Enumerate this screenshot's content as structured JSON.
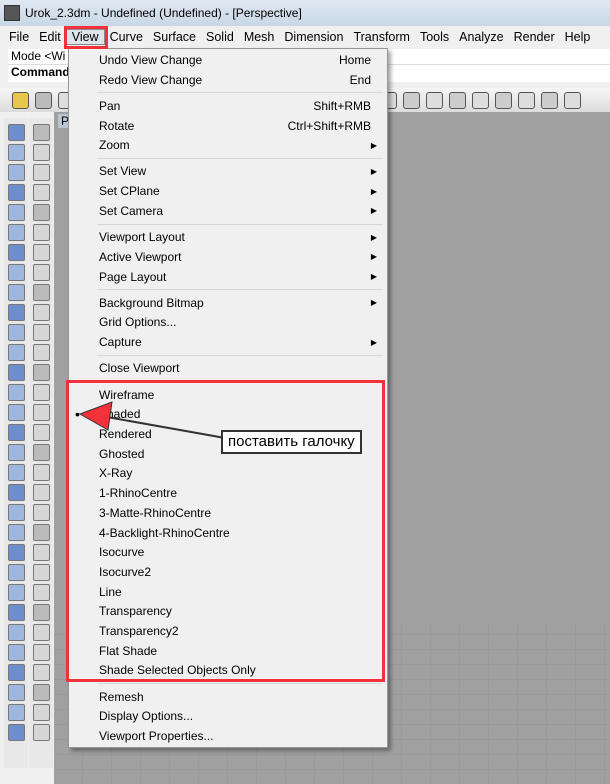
{
  "window": {
    "title": "Urok_2.3dm - Undefined (Undefined) - [Perspective]"
  },
  "menubar": [
    "File",
    "Edit",
    "View",
    "Curve",
    "Surface",
    "Solid",
    "Mesh",
    "Dimension",
    "Transform",
    "Tools",
    "Analyze",
    "Render",
    "Help"
  ],
  "mode_row": "Mode <Wi                                                                         RhinoCentre  3MatteRhinoCentre  4Backlig",
  "command_label": "Command",
  "viewport_title": "P",
  "view_menu": [
    {
      "label": "Undo View Change",
      "shortcut": "Home"
    },
    {
      "label": "Redo View Change",
      "shortcut": "End"
    },
    {
      "sep": true
    },
    {
      "label": "Pan",
      "shortcut": "Shift+RMB"
    },
    {
      "label": "Rotate",
      "shortcut": "Ctrl+Shift+RMB"
    },
    {
      "label": "Zoom",
      "submenu": true
    },
    {
      "sep": true
    },
    {
      "label": "Set View",
      "submenu": true
    },
    {
      "label": "Set CPlane",
      "submenu": true
    },
    {
      "label": "Set Camera",
      "submenu": true
    },
    {
      "sep": true
    },
    {
      "label": "Viewport Layout",
      "submenu": true
    },
    {
      "label": "Active Viewport",
      "submenu": true
    },
    {
      "label": "Page Layout",
      "submenu": true
    },
    {
      "sep": true
    },
    {
      "label": "Background Bitmap",
      "submenu": true
    },
    {
      "label": "Grid Options..."
    },
    {
      "label": "Capture",
      "submenu": true
    },
    {
      "sep": true
    },
    {
      "label": "Close Viewport"
    },
    {
      "sep": true
    },
    {
      "label": "Wireframe"
    },
    {
      "label": "Shaded",
      "checked": true
    },
    {
      "label": "Rendered"
    },
    {
      "label": "Ghosted"
    },
    {
      "label": "X-Ray"
    },
    {
      "label": "1-RhinoCentre"
    },
    {
      "label": "3-Matte-RhinoCentre"
    },
    {
      "label": "4-Backlight-RhinoCentre"
    },
    {
      "label": "Isocurve"
    },
    {
      "label": "Isocurve2"
    },
    {
      "label": "Line"
    },
    {
      "label": "Transparency"
    },
    {
      "label": "Transparency2"
    },
    {
      "label": "Flat Shade"
    },
    {
      "label": "Shade Selected Objects Only"
    },
    {
      "sep": true
    },
    {
      "label": "Remesh"
    },
    {
      "label": "Display Options..."
    },
    {
      "label": "Viewport Properties..."
    }
  ],
  "annotation": {
    "text": "поставить галочку",
    "color": "#f2323a"
  }
}
